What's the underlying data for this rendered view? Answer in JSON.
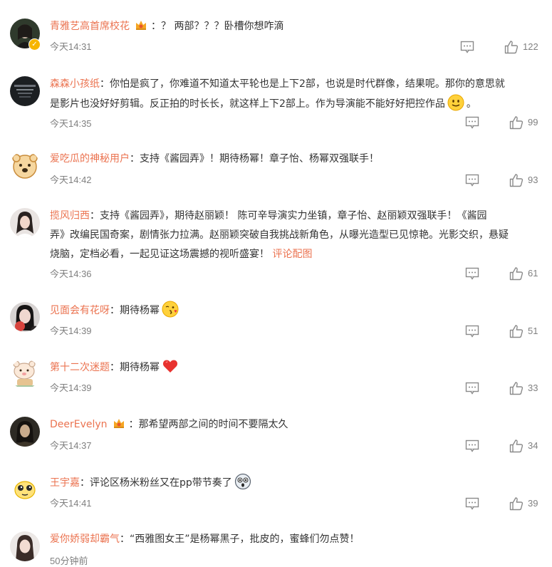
{
  "comments": [
    {
      "user": "青雅艺高首席校花",
      "sep": "：",
      "text": "？ 两部？？？卧槽你想咋滴",
      "time": "今天14:31",
      "likes": "122"
    },
    {
      "user": "森森小孩纸",
      "sep": "：",
      "text_line1": "你怕是疯了，你难道不知道太平轮也是上下2部，也说是时代群像，结果呢。那你的意思就",
      "text_line2": "是影片也没好好剪辑。反正拍的时长长，就这样上下2部上。作为导演能不能好好把控作品",
      "text_end": "。",
      "time": "今天14:35",
      "likes": "99"
    },
    {
      "user": "爱吃瓜的神秘用户",
      "sep": "：",
      "text": "支持《酱园弄》！期待杨幂！章子怡、杨幂双强联手！",
      "time": "今天14:42",
      "likes": "93"
    },
    {
      "user": "揽风归西",
      "sep": "：",
      "text_line1": "支持《酱园弄》，期待赵丽颖！ 陈可辛导演实力坐镇，章子怡、赵丽颖双强联手！《酱园",
      "text_line2": "弄》改编民国奇案，剧情张力拉满。赵丽颖突破自我挑战新角色，从曝光造型已见惊艳。光影交织，悬疑",
      "text_line3": "烧脑，定档必看，一起见证这场震撼的视听盛宴！",
      "link": "评论配图",
      "time": "今天14:36",
      "likes": "61"
    },
    {
      "user": "见面会有花呀",
      "sep": "：",
      "text": "期待杨幂",
      "time": "今天14:39",
      "likes": "51"
    },
    {
      "user": "第十二次迷题",
      "sep": "：",
      "text": "期待杨幂",
      "time": "今天14:39",
      "likes": "33"
    },
    {
      "user": "DeerEvelyn",
      "sep": "：",
      "text": "那希望两部之间的时间不要隔太久",
      "time": "今天14:37",
      "likes": "34"
    },
    {
      "user": "王宇嘉",
      "sep": "：",
      "text": "评论区杨米粉丝又在pp带节奏了",
      "time": "今天14:41",
      "likes": "39"
    },
    {
      "user": "爱你娇弱却霸气",
      "sep": "：",
      "text": "“西雅图女王”是杨幂黑子，批皮的，蜜蜂们勿点赞！",
      "time": "50分钟前"
    }
  ],
  "colors": {
    "username": "#eb7350",
    "text": "#333333",
    "meta": "#808080",
    "verified": "#f7b500"
  },
  "icons": {
    "reply": "comment-bubble-icon",
    "like": "thumbs-up-icon",
    "medal": "crown-medal-icon"
  }
}
